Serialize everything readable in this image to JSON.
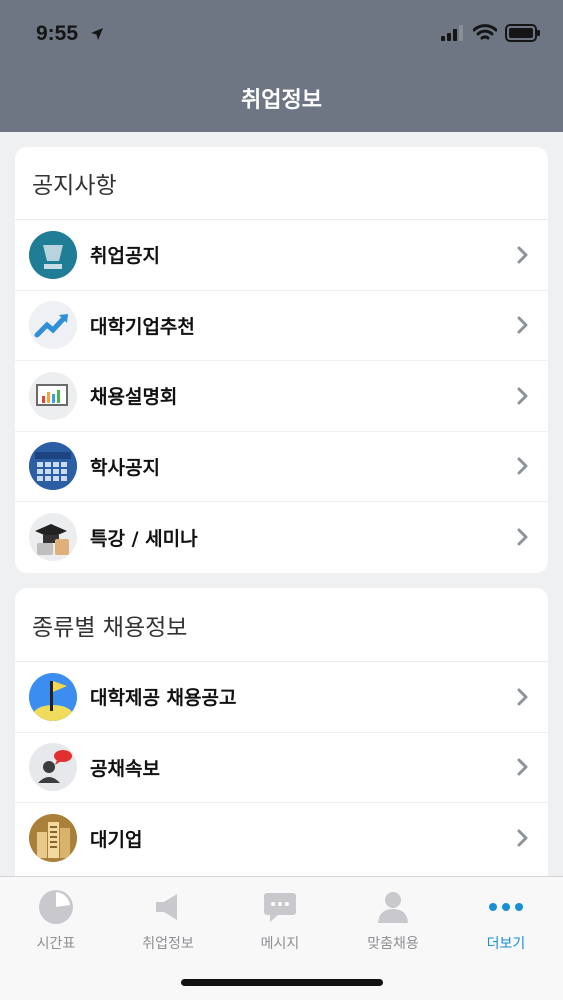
{
  "status_bar": {
    "time": "9:55"
  },
  "nav": {
    "title": "취업정보"
  },
  "sections": [
    {
      "title": "공지사항",
      "items": [
        {
          "label": "취업공지",
          "icon": "notice-icon"
        },
        {
          "label": "대학기업추천",
          "icon": "trend-chart-icon"
        },
        {
          "label": "채용설명회",
          "icon": "presentation-icon"
        },
        {
          "label": "학사공지",
          "icon": "schedule-calendar-icon"
        },
        {
          "label": "특강 / 세미나",
          "icon": "graduation-cap-icon"
        }
      ]
    },
    {
      "title": "종류별 채용정보",
      "items": [
        {
          "label": "대학제공 채용공고",
          "icon": "flag-icon"
        },
        {
          "label": "공채속보",
          "icon": "person-alert-icon"
        },
        {
          "label": "대기업",
          "icon": "buildings-icon"
        }
      ]
    }
  ],
  "tabbar": {
    "tabs": [
      {
        "label": "시간표",
        "icon": "clock-pie-icon",
        "active": false
      },
      {
        "label": "취업정보",
        "icon": "megaphone-icon",
        "active": false
      },
      {
        "label": "메시지",
        "icon": "chat-bubble-icon",
        "active": false
      },
      {
        "label": "맞춤채용",
        "icon": "person-icon",
        "active": false
      },
      {
        "label": "더보기",
        "icon": "more-dots-icon",
        "active": true
      }
    ]
  },
  "colors": {
    "header": "#6d7682",
    "accent": "#1a8fd3",
    "background": "#eff0f2"
  }
}
